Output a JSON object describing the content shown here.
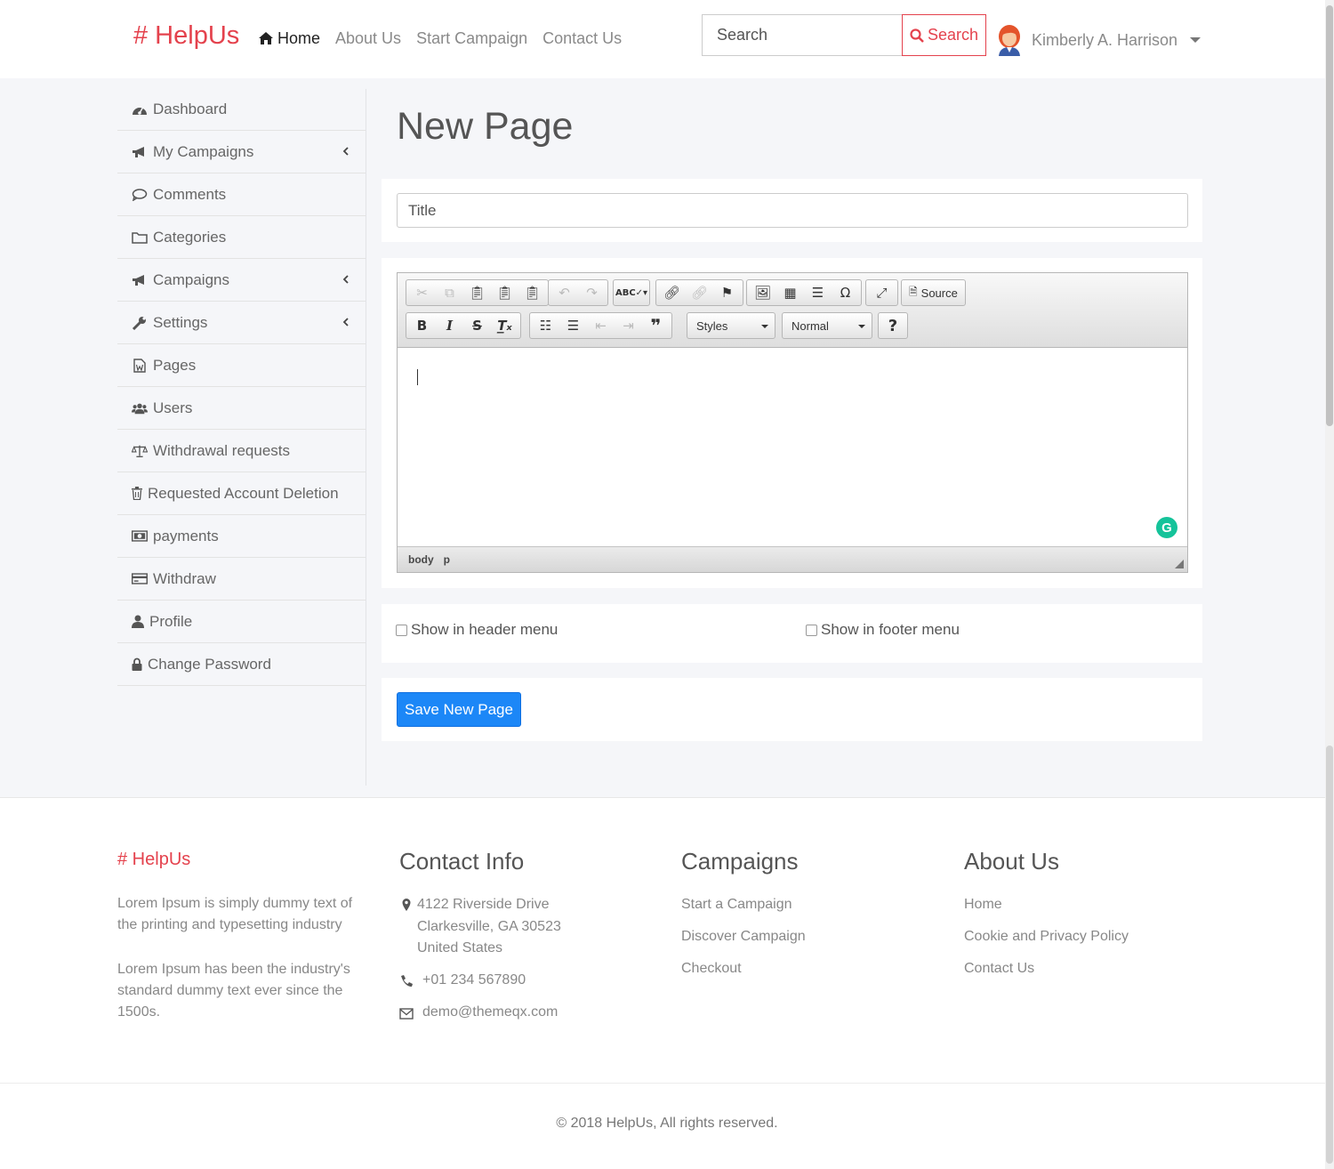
{
  "header": {
    "brand": "# HelpUs",
    "nav": [
      {
        "label": "Home",
        "active": true
      },
      {
        "label": "About Us"
      },
      {
        "label": "Start Campaign"
      },
      {
        "label": "Contact Us"
      }
    ],
    "search": {
      "placeholder": "Search",
      "button_label": "Search"
    },
    "user": {
      "name": "Kimberly A. Harrison"
    }
  },
  "sidebar": {
    "items": [
      {
        "label": "Dashboard",
        "icon": "dashboard-icon"
      },
      {
        "label": "My Campaigns",
        "icon": "bullhorn-icon",
        "expandable": true
      },
      {
        "label": "Comments",
        "icon": "comment-icon"
      },
      {
        "label": "Categories",
        "icon": "folder-icon"
      },
      {
        "label": "Campaigns",
        "icon": "bullhorn-icon",
        "expandable": true
      },
      {
        "label": "Settings",
        "icon": "wrench-icon",
        "expandable": true
      },
      {
        "label": "Pages",
        "icon": "file-word-icon"
      },
      {
        "label": "Users",
        "icon": "users-icon"
      },
      {
        "label": "Withdrawal requests",
        "icon": "balance-scale-icon"
      },
      {
        "label": "Requested Account Deletion",
        "icon": "trash-icon"
      },
      {
        "label": "payments",
        "icon": "money-icon"
      },
      {
        "label": "Withdraw",
        "icon": "credit-card-icon"
      },
      {
        "label": "Profile",
        "icon": "user-icon"
      },
      {
        "label": "Change Password",
        "icon": "lock-icon"
      }
    ]
  },
  "main": {
    "title": "New Page",
    "title_field": {
      "placeholder": "Title",
      "value": ""
    },
    "editor": {
      "source_label": "Source",
      "styles_label": "Styles",
      "format_label": "Normal",
      "help_label": "?",
      "path": [
        "body",
        "p"
      ]
    },
    "show_header_label": "Show in header menu",
    "show_footer_label": "Show in footer menu",
    "save_label": "Save New Page"
  },
  "footer": {
    "brand": "# HelpUs",
    "about_text_1": "Lorem Ipsum is simply dummy text of the printing and typesetting industry",
    "about_text_2": "Lorem Ipsum has been the industry's standard dummy text ever since the 1500s.",
    "contact": {
      "heading": "Contact Info",
      "address": [
        "4122 Riverside Drive",
        "Clarkesville, GA 30523",
        "United States"
      ],
      "phone": "+01 234 567890",
      "email": "demo@themeqx.com"
    },
    "campaigns": {
      "heading": "Campaigns",
      "links": [
        "Start a Campaign",
        "Discover Campaign",
        "Checkout"
      ]
    },
    "about": {
      "heading": "About Us",
      "links": [
        "Home",
        "Cookie and Privacy Policy",
        "Contact Us"
      ]
    },
    "copyright": "© 2018 HelpUs, All rights reserved."
  },
  "colors": {
    "brand": "#e4424d",
    "primary_button": "#1c87f7",
    "page_background": "#f5f6f9"
  }
}
